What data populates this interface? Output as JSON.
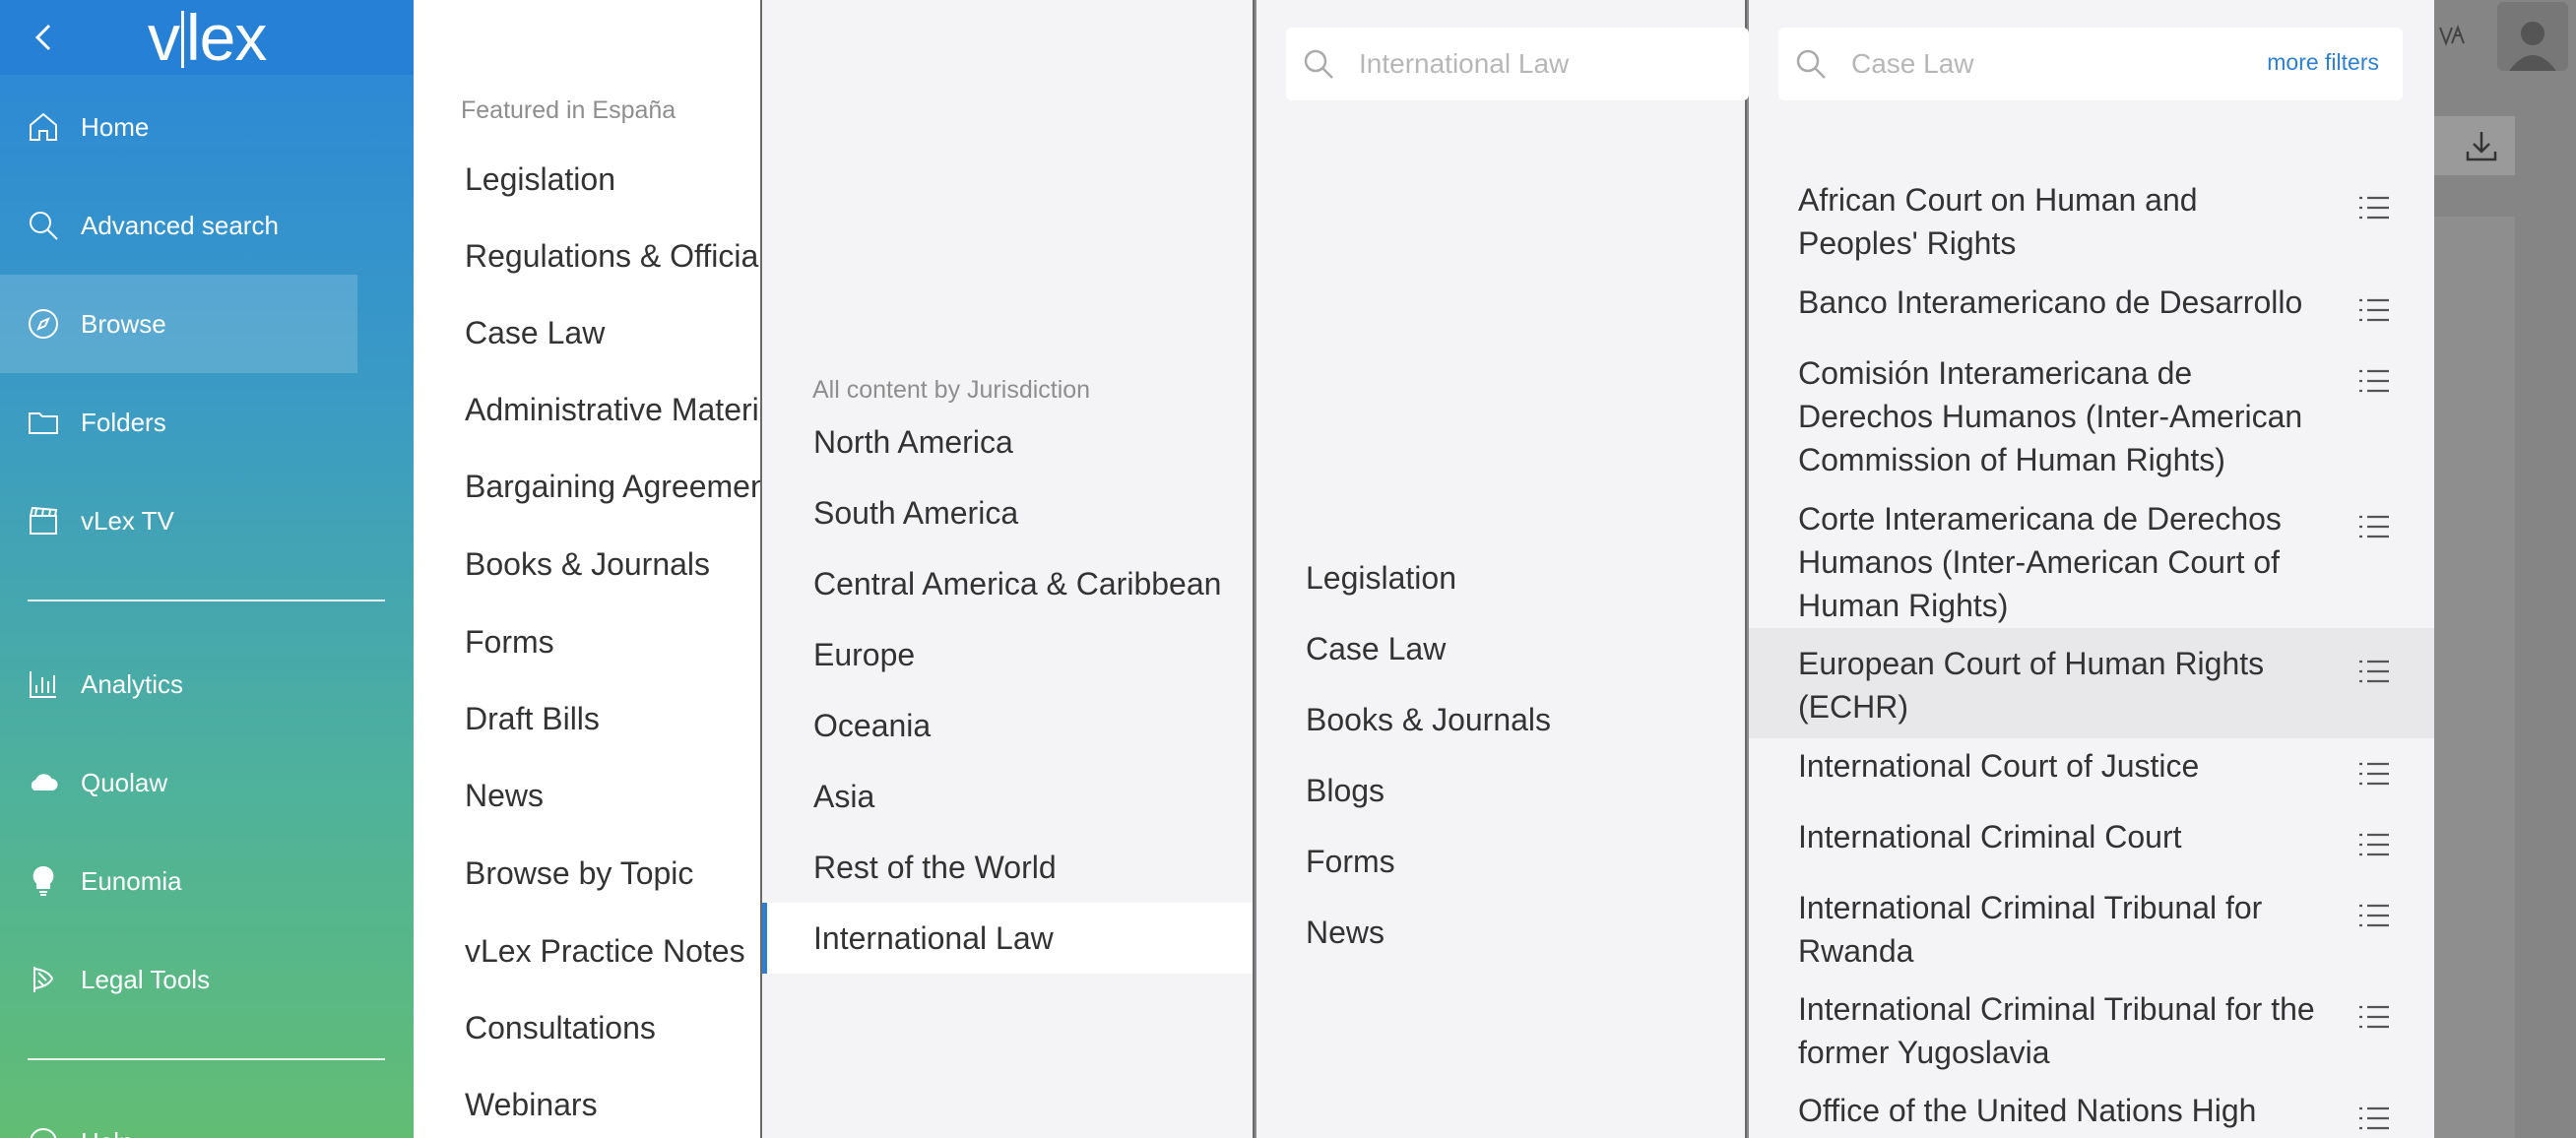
{
  "sidebar": {
    "logo": "vlex",
    "nav": [
      {
        "label": "Home",
        "icon": "home-icon"
      },
      {
        "label": "Advanced search",
        "icon": "search-icon"
      },
      {
        "label": "Browse",
        "icon": "compass-icon",
        "active": true
      },
      {
        "label": "Folders",
        "icon": "folder-icon"
      },
      {
        "label": "vLex TV",
        "icon": "clapperboard-icon"
      }
    ],
    "tools": [
      {
        "label": "Analytics",
        "icon": "bar-chart-icon"
      },
      {
        "label": "Quolaw",
        "icon": "cloud-icon"
      },
      {
        "label": "Eunomia",
        "icon": "lightbulb-icon"
      },
      {
        "label": "Legal Tools",
        "icon": "legal-tools-icon"
      }
    ],
    "partial_label": "Help"
  },
  "panel1": {
    "section_label": "Featured in España",
    "items": [
      "Legislation",
      "Regulations & Official",
      "Case Law",
      "Administrative Material",
      "Bargaining Agreements",
      "Books & Journals",
      "Forms",
      "Draft Bills",
      "News",
      "Browse by Topic",
      "vLex Practice Notes",
      "Consultations",
      "Webinars"
    ]
  },
  "panel2": {
    "section_label": "All content by Jurisdiction",
    "items": [
      "North America",
      "South America",
      "Central America & Caribbean",
      "Europe",
      "Oceania",
      "Asia",
      "Rest of the World",
      "International Law"
    ],
    "selected": "International Law"
  },
  "panel3": {
    "search_placeholder": "International Law",
    "items": [
      "Legislation",
      "Case Law",
      "Books & Journals",
      "Blogs",
      "Forms",
      "News"
    ]
  },
  "panel4": {
    "search_placeholder": "Case Law",
    "more_filters": "more filters",
    "courts": [
      "African Court on Human and Peoples' Rights",
      "Banco Interamericano de Desarrollo",
      "Comisión Interamericana de Derechos Humanos (Inter-American Commission of Human Rights)",
      "Corte Interamericana de Derechos Humanos (Inter-American Court of Human Rights)",
      "European Court of Human Rights (ECHR)",
      "International Court of Justice",
      "International Criminal Court",
      "International Criminal Tribunal for Rwanda",
      "International Criminal Tribunal for the former Yugoslavia",
      "Office of the United Nations High"
    ],
    "highlighted": "European Court of Human Rights (ECHR)"
  },
  "colors": {
    "accent": "#2f7fd1",
    "sidebar_top": "#2580d6",
    "sidebar_bottom": "#62bd73"
  }
}
